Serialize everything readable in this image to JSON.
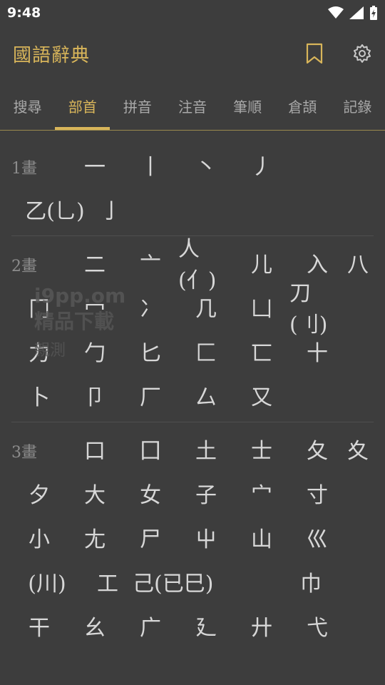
{
  "status": {
    "time": "9:48"
  },
  "app": {
    "title": "國語辭典"
  },
  "icons": {
    "bookmark": "bookmark-icon",
    "settings": "gear-icon"
  },
  "colors": {
    "accent": "#d8b55a",
    "background": "#3d3d3d"
  },
  "tabs": [
    "搜尋",
    "部首",
    "拼音",
    "注音",
    "筆順",
    "倉頡",
    "記錄"
  ],
  "active_tab": "部首",
  "sections": [
    {
      "label": "1畫",
      "radicals": [
        "一",
        "丨",
        "丶",
        "丿",
        "乙(乚)",
        "亅"
      ]
    },
    {
      "label": "2畫",
      "radicals": [
        "二",
        "亠",
        "人(亻)",
        "儿",
        "入",
        "八",
        "冂",
        "冖",
        "冫",
        "几",
        "凵",
        "刀(刂)",
        "力",
        "勹",
        "匕",
        "匚",
        "匸",
        "十",
        "卜",
        "卩",
        "厂",
        "厶",
        "又"
      ]
    },
    {
      "label": "3畫",
      "radicals": [
        "口",
        "囗",
        "土",
        "士",
        "夂",
        "夊",
        "夕",
        "大",
        "女",
        "子",
        "宀",
        "寸",
        "小",
        "尢",
        "尸",
        "屮",
        "山",
        "巛",
        "(川)",
        "工",
        "己(已巳)",
        "巾",
        "干",
        "幺",
        "广",
        "廴",
        "廾",
        "弋"
      ]
    }
  ],
  "watermark": {
    "line1": "i9pp.om",
    "line2": "精品下載",
    "line3": "親測"
  }
}
